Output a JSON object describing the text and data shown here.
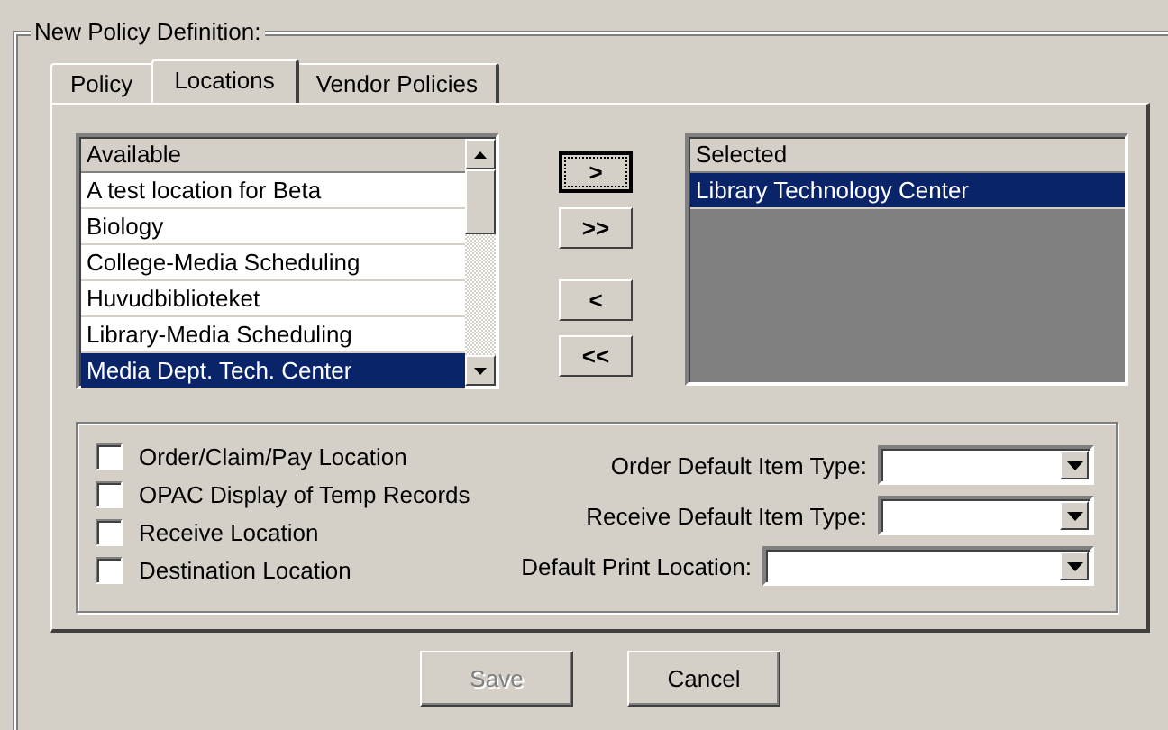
{
  "group_title": "New  Policy Definition:",
  "tabs": [
    {
      "label": "Policy",
      "selected": false
    },
    {
      "label": "Locations",
      "selected": true
    },
    {
      "label": "Vendor Policies",
      "selected": false
    }
  ],
  "available": {
    "header": "Available",
    "items": [
      {
        "label": "A test location for Beta",
        "selected": false
      },
      {
        "label": "Biology",
        "selected": false
      },
      {
        "label": "College-Media Scheduling",
        "selected": false
      },
      {
        "label": "Huvudbiblioteket",
        "selected": false
      },
      {
        "label": "Library-Media Scheduling",
        "selected": false
      },
      {
        "label": "Media Dept. Tech. Center",
        "selected": true
      }
    ]
  },
  "move_buttons": [
    {
      "label": ">",
      "focused": true
    },
    {
      "label": ">>",
      "focused": false
    },
    {
      "label": "<",
      "focused": false
    },
    {
      "label": "<<",
      "focused": false
    }
  ],
  "selected_list": {
    "header": "Selected",
    "items": [
      {
        "label": "Library Technology Center",
        "selected": true
      }
    ]
  },
  "checkboxes": [
    {
      "label": "Order/Claim/Pay Location",
      "checked": false
    },
    {
      "label": "OPAC Display of Temp Records",
      "checked": false
    },
    {
      "label": "Receive Location",
      "checked": false
    },
    {
      "label": "Destination Location",
      "checked": false
    }
  ],
  "dropdowns": [
    {
      "label": "Order Default Item Type:"
    },
    {
      "label": "Receive Default Item Type:"
    },
    {
      "label": "Default Print Location:"
    }
  ],
  "buttons": [
    {
      "label": "Save",
      "disabled": true
    },
    {
      "label": "Cancel",
      "disabled": false
    }
  ]
}
